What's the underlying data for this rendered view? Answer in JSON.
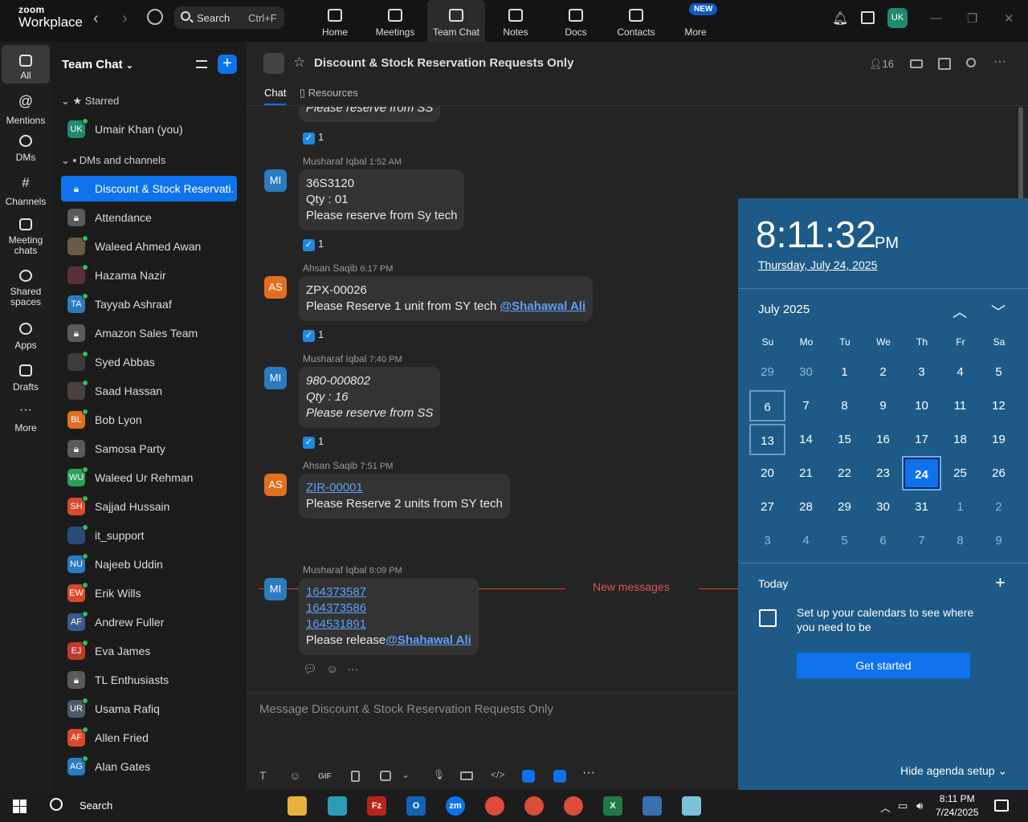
{
  "app": {
    "logo_line1": "zoom",
    "logo_line2": "Workplace",
    "back": "‹",
    "forward": "›"
  },
  "search": {
    "label": "Search",
    "shortcut": "Ctrl+F"
  },
  "tabs": [
    {
      "label": "Home"
    },
    {
      "label": "Meetings"
    },
    {
      "label": "Team Chat"
    },
    {
      "label": "Notes"
    },
    {
      "label": "Docs"
    },
    {
      "label": "Contacts"
    },
    {
      "label": "More",
      "badge": "NEW"
    }
  ],
  "user": {
    "initials": "UK"
  },
  "rail": [
    {
      "label": "All"
    },
    {
      "label": "Mentions"
    },
    {
      "label": "DMs"
    },
    {
      "label": "Channels"
    },
    {
      "label": "Meeting chats"
    },
    {
      "label": "Shared spaces"
    },
    {
      "label": "Apps"
    },
    {
      "label": "Drafts"
    },
    {
      "label": "More"
    }
  ],
  "sidebar": {
    "title": "Team Chat",
    "starred_label": "Starred",
    "dms_label": "DMs and channels",
    "starred": [
      {
        "initials": "UK",
        "name": "Umair Khan (you)",
        "color": "#1f8a70"
      }
    ],
    "items": [
      {
        "initials": "",
        "name": "Discount & Stock Reservati...",
        "color": "#0e72ed",
        "lock": true,
        "selected": true
      },
      {
        "initials": "",
        "name": "Attendance",
        "color": "#5a5a5a",
        "lock": true
      },
      {
        "initials": "",
        "name": "Waleed Ahmed Awan",
        "color": "#6b5a48"
      },
      {
        "initials": "",
        "name": "Hazama Nazir",
        "color": "#5a3038"
      },
      {
        "initials": "TA",
        "name": "Tayyab Ashraaf",
        "color": "#2a7bbf"
      },
      {
        "initials": "",
        "name": "Amazon Sales Team",
        "color": "#5a5a5a",
        "lock": true
      },
      {
        "initials": "",
        "name": "Syed Abbas",
        "color": "#3c3c3c"
      },
      {
        "initials": "",
        "name": "Saad Hassan",
        "color": "#4a4040"
      },
      {
        "initials": "BL",
        "name": "Bob Lyon",
        "color": "#e0701e"
      },
      {
        "initials": "",
        "name": "Samosa Party",
        "color": "#5a5a5a",
        "lock": true
      },
      {
        "initials": "WU",
        "name": "Waleed Ur Rehman",
        "color": "#2aa05a"
      },
      {
        "initials": "SH",
        "name": "Sajjad Hussain",
        "color": "#d84a2a"
      },
      {
        "initials": "",
        "name": "it_support",
        "color": "#2a4a7a"
      },
      {
        "initials": "NU",
        "name": "Najeeb Uddin",
        "color": "#2a7bbf"
      },
      {
        "initials": "EW",
        "name": "Erik Wills",
        "color": "#d84a2a"
      },
      {
        "initials": "AF",
        "name": "Andrew Fuller",
        "color": "#3a5a8a"
      },
      {
        "initials": "EJ",
        "name": "Eva James",
        "color": "#c0392b"
      },
      {
        "initials": "",
        "name": "TL Enthusiasts",
        "color": "#5a5a5a",
        "lock": true
      },
      {
        "initials": "UR",
        "name": "Usama Rafiq",
        "color": "#4a5a6a"
      },
      {
        "initials": "AF",
        "name": "Allen Fried",
        "color": "#d84a2a"
      },
      {
        "initials": "AG",
        "name": "Alan Gates",
        "color": "#2a7bbf"
      }
    ]
  },
  "channel": {
    "title": "Discount & Stock Reservation Requests Only",
    "members": "16",
    "tab_chat": "Chat",
    "tab_resources": "Resources"
  },
  "messages": {
    "m0": {
      "line": "Please reserve from SS",
      "react": "1"
    },
    "m1": {
      "sender": "Musharaf Iqbal",
      "time": "1:52 AM",
      "initials": "MI",
      "lines": [
        "36S3120",
        "Qty : 01",
        "Please reserve from  Sy tech"
      ],
      "react": "1"
    },
    "m2": {
      "sender": "Ahsan Saqib",
      "time": "6:17 PM",
      "initials": "AS",
      "line1": "ZPX-00026",
      "line2": "Please Reserve 1 unit from SY tech ",
      "mention": "@Shahawal Ali",
      "react": "1"
    },
    "m3": {
      "sender": "Musharaf Iqbal",
      "time": "7:40 PM",
      "initials": "MI",
      "lines": [
        "980-000802",
        "Qty : 16",
        "Please reserve from SS"
      ],
      "react": "1"
    },
    "m4": {
      "sender": "Ahsan Saqib",
      "time": "7:51 PM",
      "initials": "AS",
      "link": "ZIR-00001",
      "line2": "Please Reserve 2 units from SY tech"
    },
    "new_label": "New messages",
    "m5": {
      "sender": "Musharaf Iqbal",
      "time": "8:09 PM",
      "initials": "MI",
      "links": [
        "164373587",
        "164373586",
        "164531891"
      ],
      "text": "Please release",
      "mention": "@Shahawal Ali"
    }
  },
  "composer": {
    "placeholder": "Message Discount & Stock Reservation Requests Only",
    "gif": "GIF"
  },
  "calendar": {
    "time": "8:11:32",
    "ampm": "PM",
    "date": "Thursday, July 24, 2025",
    "month": "July 2025",
    "dow": [
      "Su",
      "Mo",
      "Tu",
      "We",
      "Th",
      "Fr",
      "Sa"
    ],
    "weeks": [
      [
        "29",
        "30",
        "1",
        "2",
        "3",
        "4",
        "5"
      ],
      [
        "6",
        "7",
        "8",
        "9",
        "10",
        "11",
        "12"
      ],
      [
        "13",
        "14",
        "15",
        "16",
        "17",
        "18",
        "19"
      ],
      [
        "20",
        "21",
        "22",
        "23",
        "24",
        "25",
        "26"
      ],
      [
        "27",
        "28",
        "29",
        "30",
        "31",
        "1",
        "2"
      ],
      [
        "3",
        "4",
        "5",
        "6",
        "7",
        "8",
        "9"
      ]
    ],
    "today": "24",
    "today_label": "Today",
    "setup_text": "Set up your calendars to see where you need to be",
    "get_started": "Get started",
    "hide": "Hide agenda setup"
  },
  "taskbar": {
    "search": "Search",
    "time": "8:11 PM",
    "date": "7/24/2025"
  }
}
